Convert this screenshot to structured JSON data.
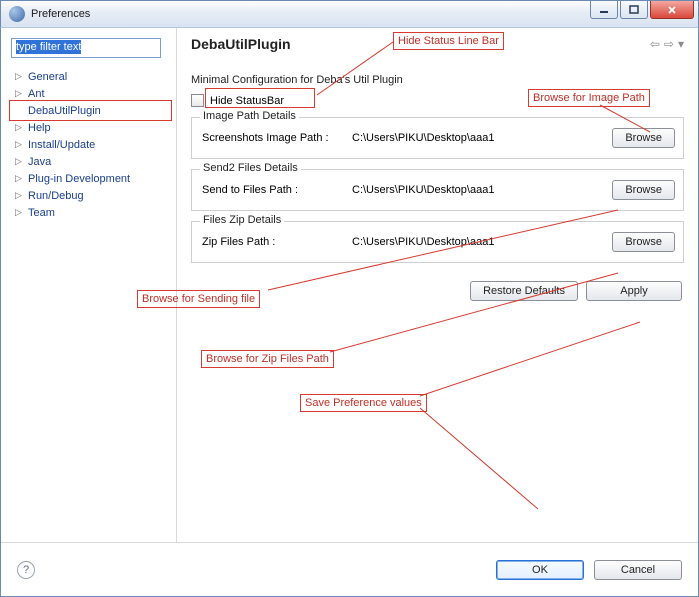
{
  "window": {
    "title": "Preferences"
  },
  "filter": {
    "text": "type filter text"
  },
  "tree": {
    "items": [
      {
        "label": "General"
      },
      {
        "label": "Ant"
      },
      {
        "label": "DebaUtilPlugin"
      },
      {
        "label": "Help"
      },
      {
        "label": "Install/Update"
      },
      {
        "label": "Java"
      },
      {
        "label": "Plug-in Development"
      },
      {
        "label": "Run/Debug"
      },
      {
        "label": "Team"
      }
    ]
  },
  "page": {
    "heading": "DebaUtilPlugin",
    "subtitle": "Minimal Configuration for Deba's Util Plugin",
    "hide_statusbar_label": "Hide StatusBar",
    "groups": {
      "image": {
        "legend": "Image Path Details",
        "label": "Screenshots Image Path :",
        "value": "C:\\Users\\PIKU\\Desktop\\aaa1",
        "browse": "Browse"
      },
      "send": {
        "legend": "Send2 Files Details",
        "label": "Send to Files Path :",
        "value": "C:\\Users\\PIKU\\Desktop\\aaa1",
        "browse": "Browse"
      },
      "zip": {
        "legend": "Files Zip Details",
        "label": "Zip Files Path :",
        "value": "C:\\Users\\PIKU\\Desktop\\aaa1",
        "browse": "Browse"
      }
    },
    "restore": "Restore Defaults",
    "apply": "Apply"
  },
  "footer": {
    "ok": "OK",
    "cancel": "Cancel"
  },
  "annotations": {
    "hide_status": "Hide Status Line Bar",
    "browse_image": "Browse for Image Path",
    "browse_send": "Browse for Sending file",
    "browse_zip": "Browse for Zip Files Path",
    "save_pref": "Save Preference values"
  }
}
